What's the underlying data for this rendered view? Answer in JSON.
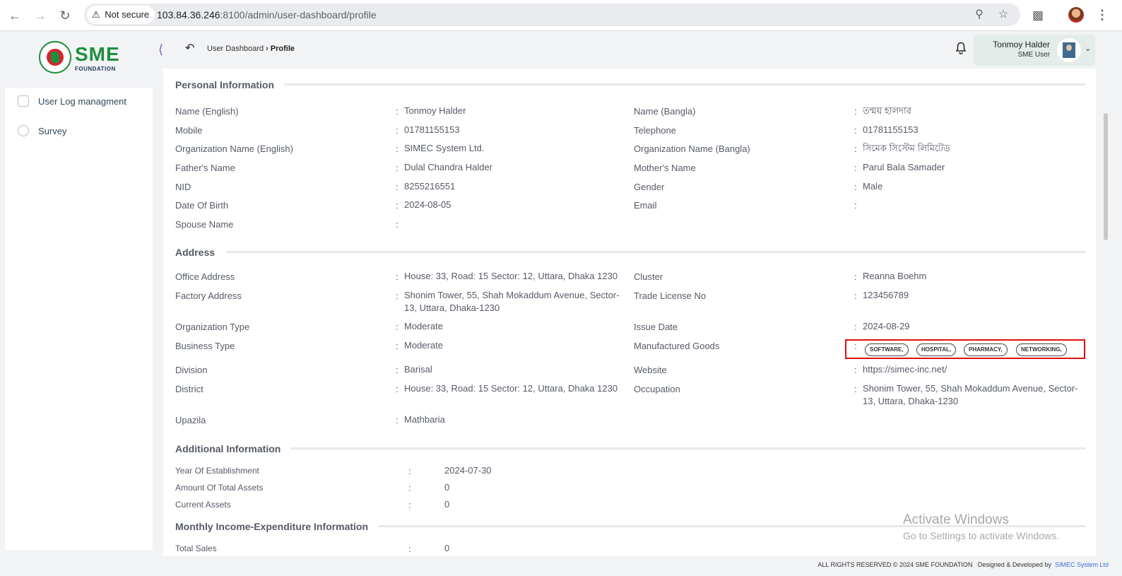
{
  "browser": {
    "security_label": "Not secure",
    "url_host": "103.84.36.246",
    "url_rest": ":8100/admin/user-dashboard/profile"
  },
  "logo": {
    "sme_text": "SME",
    "foundation_text": "FOUNDATION"
  },
  "breadcrumb": {
    "parent": "User Dashboard",
    "current": "Profile"
  },
  "user": {
    "name": "Tonmoy Halder",
    "role": "SME User"
  },
  "sidebar": {
    "items": [
      {
        "label": "User Log managment",
        "icon": "log-icon"
      },
      {
        "label": "Survey",
        "icon": "pie-chart-icon"
      }
    ]
  },
  "sections": {
    "personal": "Personal Information",
    "address": "Address",
    "additional": "Additional Information",
    "monthly": "Monthly Income-Expenditure Information"
  },
  "personal": {
    "name_en_label": "Name (English)",
    "name_en": "Tonmoy Halder",
    "name_bn_label": "Name (Bangla)",
    "name_bn": "তন্ময় হালদার",
    "mobile_label": "Mobile",
    "mobile": "01781155153",
    "telephone_label": "Telephone",
    "telephone": "01781155153",
    "org_en_label": "Organization Name (English)",
    "org_en": "SIMEC System Ltd.",
    "org_bn_label": "Organization Name (Bangla)",
    "org_bn": "সিমেক সিস্টেম লিমিটেড",
    "father_label": "Father's Name",
    "father": "Dulal Chandra Halder",
    "mother_label": "Mother's Name",
    "mother": "Parul Bala Samader",
    "nid_label": "NID",
    "nid": "8255216551",
    "gender_label": "Gender",
    "gender": "Male",
    "dob_label": "Date Of Birth",
    "dob": "2024-08-05",
    "email_label": "Email",
    "email": "",
    "spouse_label": "Spouse Name",
    "spouse": ""
  },
  "address": {
    "office_label": "Office Address",
    "office": "House: 33, Road: 15 Sector: 12, Uttara, Dhaka 1230",
    "cluster_label": "Cluster",
    "cluster": "Reanna Boehm",
    "factory_label": "Factory Address",
    "factory": "Shonim Tower, 55, Shah Mokaddum Avenue, Sector-13, Uttara, Dhaka-1230",
    "trade_label": "Trade License No",
    "trade": "123456789",
    "org_type_label": "Organization Type",
    "org_type": "Moderate",
    "issue_label": "Issue Date",
    "issue": "2024-08-29",
    "business_label": "Business Type",
    "business": "Moderate",
    "goods_label": "Manufactured Goods",
    "goods": [
      "SOFTWARE,",
      "HOSPITAL,",
      "PHARMACY,",
      "NETWORKING,"
    ],
    "division_label": "Division",
    "division": "Barisal",
    "website_label": "Website",
    "website": "https://simec-inc.net/",
    "district_label": "District",
    "district": "House: 33, Road: 15 Sector: 12, Uttara, Dhaka 1230",
    "occupation_label": "Occupation",
    "occupation": "Shonim Tower, 55, Shah Mokaddum Avenue, Sector-13, Uttara, Dhaka-1230",
    "upazila_label": "Upazila",
    "upazila": "Mathbaria"
  },
  "additional": {
    "year_label": "Year Of Establishment",
    "year": "2024-07-30",
    "total_assets_label": "Amount Of Total Assets",
    "total_assets": "0",
    "current_assets_label": "Current Assets",
    "current_assets": "0"
  },
  "monthly": {
    "total_sales_label": "Total Sales",
    "total_sales": "0"
  },
  "watermark": {
    "title": "Activate Windows",
    "subtitle": "Go to Settings to activate Windows."
  },
  "footer": {
    "rights": "ALL RIGHTS RESERVED © 2024 SME FOUNDATION",
    "designed": "Designed & Developed by",
    "company": "SIMEC System Ltd"
  }
}
